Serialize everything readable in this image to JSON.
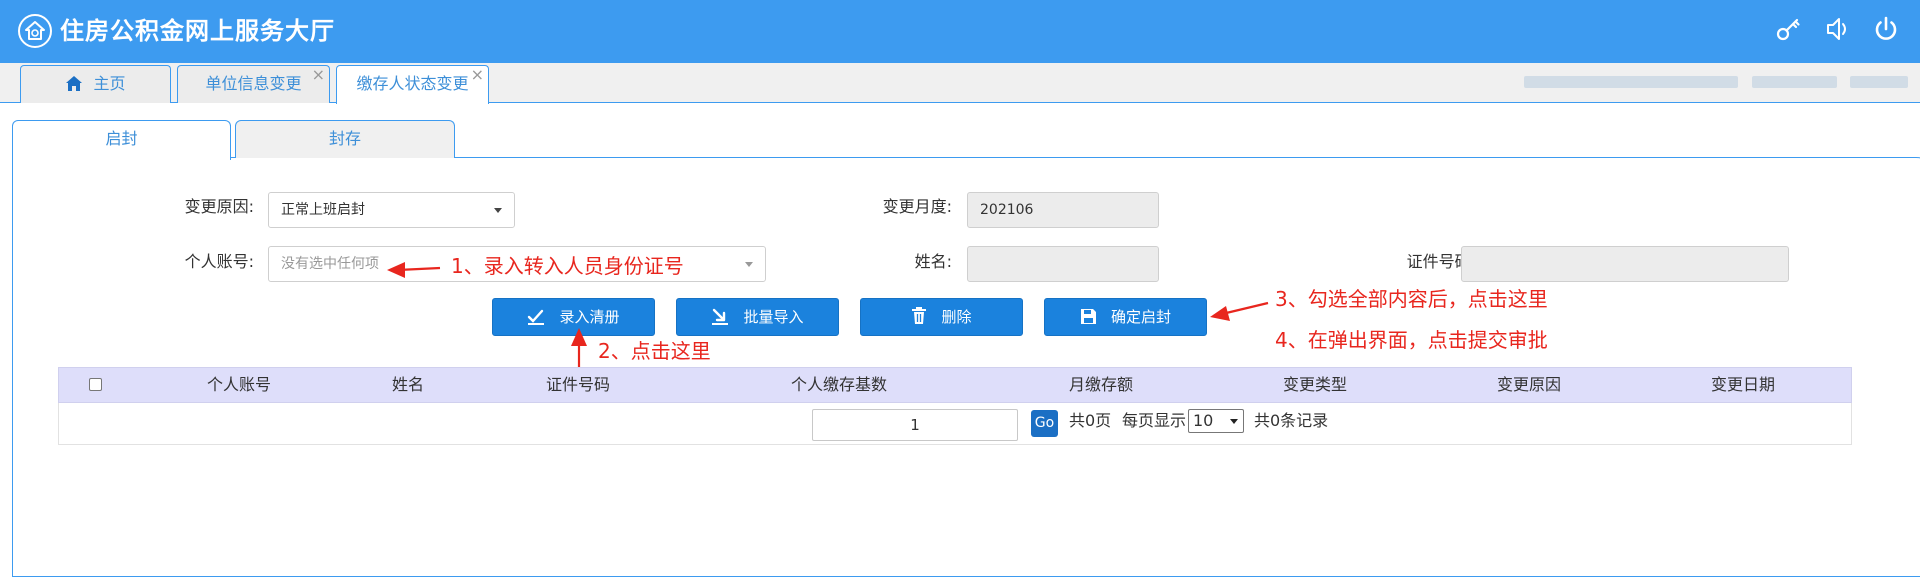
{
  "header": {
    "title": "住房公积金网上服务大厅",
    "icons": [
      "home-logo-icon",
      "key-icon",
      "volume-icon",
      "power-icon"
    ],
    "color": "#3d9bf0"
  },
  "nav_tabs": [
    {
      "label": "主页",
      "icon": "home-icon",
      "active": false,
      "closable": false
    },
    {
      "label": "单位信息变更",
      "active": false,
      "closable": true
    },
    {
      "label": "缴存人状态变更",
      "active": true,
      "closable": true
    }
  ],
  "close_glyph": "×",
  "sub_tabs": [
    {
      "label": "启封",
      "active": true
    },
    {
      "label": "封存",
      "active": false
    }
  ],
  "form": {
    "change_reason": {
      "label": "变更原因:",
      "value": "正常上班启封"
    },
    "change_month": {
      "label": "变更月度:",
      "value": "202106"
    },
    "personal_account": {
      "label": "个人账号:",
      "placeholder": "没有选中任何项"
    },
    "name": {
      "label": "姓名:",
      "value": ""
    },
    "id_number": {
      "label": "证件号码:",
      "value": ""
    }
  },
  "buttons": {
    "entry_list": "录入清册",
    "batch_import": "批量导入",
    "delete": "删除",
    "confirm_unseal": "确定启封"
  },
  "annotations": {
    "a1": "1、录入转入人员身份证号",
    "a2": "2、点击这里",
    "a3": "3、勾选全部内容后，点击这里",
    "a4": "4、在弹出界面，点击提交审批",
    "color": "#e8261e"
  },
  "table": {
    "columns": [
      "个人账号",
      "姓名",
      "证件号码",
      "个人缴存基数",
      "月缴存额",
      "变更类型",
      "变更原因",
      "变更日期"
    ],
    "rows": []
  },
  "pager": {
    "page_value": "1",
    "go_label": "Go",
    "total_pages": "共0页",
    "per_page_label": "每页显示",
    "per_page_value": "10",
    "total_records": "共0条记录"
  }
}
